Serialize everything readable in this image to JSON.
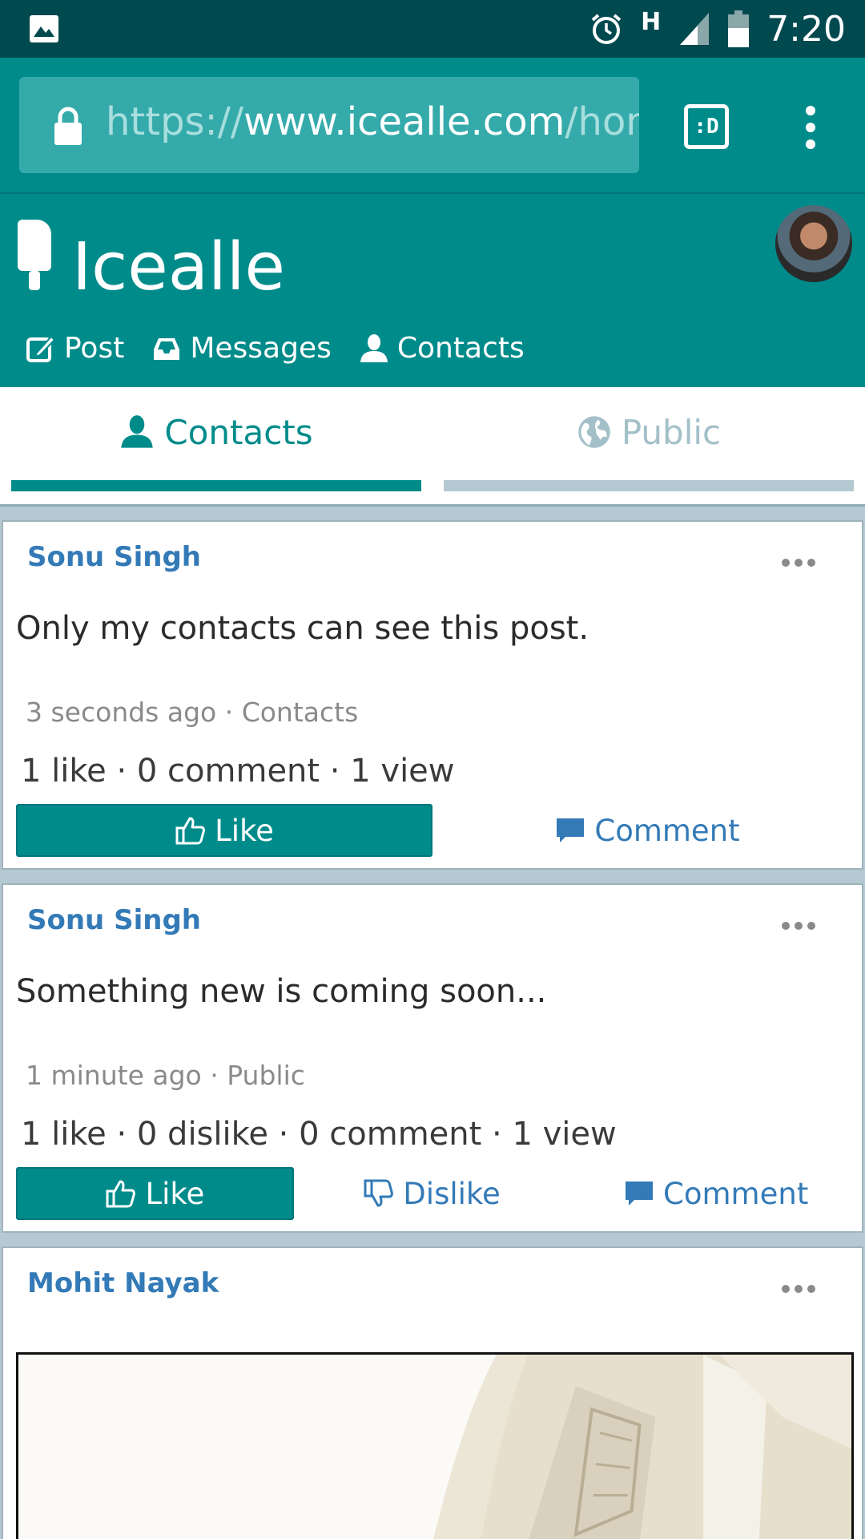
{
  "status_bar": {
    "network": "H",
    "time": "7:20"
  },
  "browser": {
    "url_scheme": "https://",
    "url_host": "www.icealle.com",
    "url_path": "/home",
    "tab_switch_label": ":D"
  },
  "app": {
    "brand": "Icealle",
    "nav": [
      {
        "label": "Post",
        "icon": "edit-icon"
      },
      {
        "label": "Messages",
        "icon": "inbox-icon"
      },
      {
        "label": "Contacts",
        "icon": "user-icon"
      }
    ]
  },
  "tabs": [
    {
      "label": "Contacts",
      "icon": "user-icon",
      "active": true
    },
    {
      "label": "Public",
      "icon": "globe-icon",
      "active": false
    }
  ],
  "posts": [
    {
      "author": "Sonu Singh",
      "body": "Only my contacts can see this post.",
      "time": "3 seconds ago",
      "audience": "Contacts",
      "stats": "1 like · 0 comment · 1 view",
      "actions": {
        "like": "Like",
        "comment": "Comment"
      }
    },
    {
      "author": "Sonu Singh",
      "body": "Something new is coming soon...",
      "time": "1 minute ago",
      "audience": "Public",
      "stats": "1 like · 0 dislike · 0 comment · 1 view",
      "actions": {
        "like": "Like",
        "dislike": "Dislike",
        "comment": "Comment"
      }
    },
    {
      "author": "Mohit Nayak"
    }
  ],
  "colors": {
    "teal": "#008b8b",
    "status_bar": "#00494f",
    "link_blue": "#337ab7",
    "inactive_tab": "#a3c0c8"
  },
  "meta_separator": " · "
}
